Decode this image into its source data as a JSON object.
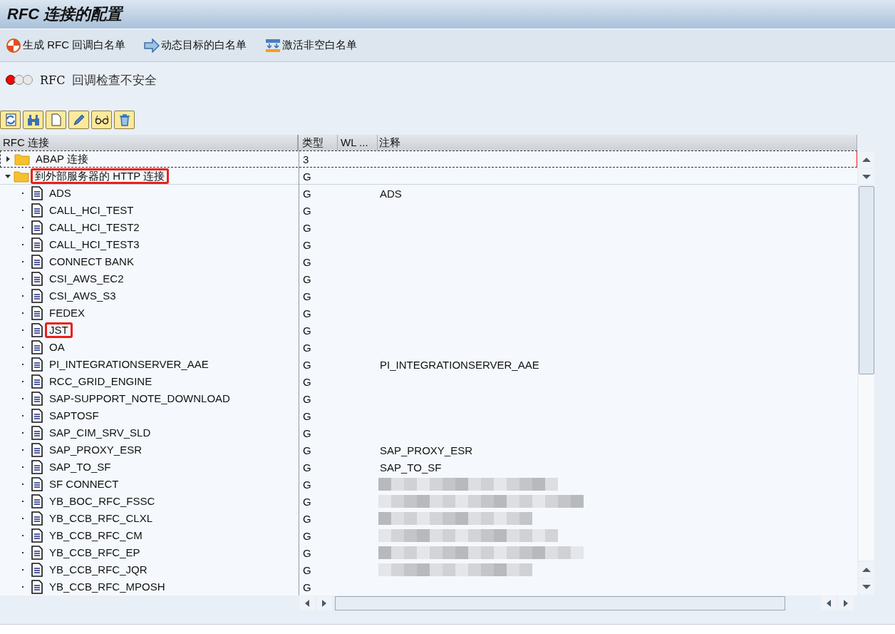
{
  "window": {
    "title": "RFC 连接的配置"
  },
  "app_toolbar": [
    {
      "kind": "generate",
      "label": "生成 RFC 回调白名单"
    },
    {
      "kind": "arrow",
      "label": "动态目标的白名单"
    },
    {
      "kind": "activate",
      "label": "激活非空白名单"
    }
  ],
  "status": {
    "alert": true,
    "label": "RFC",
    "text": "回调检查不安全"
  },
  "icon_toolbar": [
    {
      "kind": "refresh"
    },
    {
      "kind": "binoculars"
    },
    {
      "kind": "page"
    },
    {
      "kind": "pencil"
    },
    {
      "kind": "glasses"
    },
    {
      "kind": "trash"
    }
  ],
  "table": {
    "columns": [
      "RFC 连接",
      "类型",
      "WL ...",
      "注释"
    ],
    "tree": [
      {
        "label": "ABAP 连接",
        "type": "3",
        "expanded": false,
        "focused": true,
        "highlighted": false
      },
      {
        "label": "到外部服务器的 HTTP 连接",
        "type": "G",
        "expanded": true,
        "focused": false,
        "highlighted": true,
        "children": [
          {
            "label": "ADS",
            "type": "G",
            "comment": "ADS",
            "highlighted": false,
            "redacted": false
          },
          {
            "label": "CALL_HCI_TEST",
            "type": "G",
            "highlighted": false,
            "redacted": false
          },
          {
            "label": "CALL_HCI_TEST2",
            "type": "G",
            "highlighted": false,
            "redacted": false
          },
          {
            "label": "CALL_HCI_TEST3",
            "type": "G",
            "highlighted": false,
            "redacted": false
          },
          {
            "label": "CONNECT BANK",
            "type": "G",
            "highlighted": false,
            "redacted": false
          },
          {
            "label": "CSI_AWS_EC2",
            "type": "G",
            "highlighted": false,
            "redacted": false
          },
          {
            "label": "CSI_AWS_S3",
            "type": "G",
            "highlighted": false,
            "redacted": false
          },
          {
            "label": "FEDEX",
            "type": "G",
            "highlighted": false,
            "redacted": false
          },
          {
            "label": "JST",
            "type": "G",
            "highlighted": true,
            "redacted": false
          },
          {
            "label": "OA",
            "type": "G",
            "highlighted": false,
            "redacted": false
          },
          {
            "label": "PI_INTEGRATIONSERVER_AAE",
            "type": "G",
            "comment": "PI_INTEGRATIONSERVER_AAE",
            "highlighted": false,
            "redacted": false
          },
          {
            "label": "RCC_GRID_ENGINE",
            "type": "G",
            "highlighted": false,
            "redacted": false
          },
          {
            "label": "SAP-SUPPORT_NOTE_DOWNLOAD",
            "type": "G",
            "highlighted": false,
            "redacted": false
          },
          {
            "label": "SAPTOSF",
            "type": "G",
            "highlighted": false,
            "redacted": false
          },
          {
            "label": "SAP_CIM_SRV_SLD",
            "type": "G",
            "highlighted": false,
            "redacted": false
          },
          {
            "label": "SAP_PROXY_ESR",
            "type": "G",
            "comment": "SAP_PROXY_ESR",
            "highlighted": false,
            "redacted": false
          },
          {
            "label": "SAP_TO_SF",
            "type": "G",
            "comment": "SAP_TO_SF",
            "highlighted": false,
            "redacted": false
          },
          {
            "label": "SF CONNECT",
            "type": "G",
            "highlighted": false,
            "redacted": true
          },
          {
            "label": "YB_BOC_RFC_FSSC",
            "type": "G",
            "highlighted": false,
            "redacted": true
          },
          {
            "label": "YB_CCB_RFC_CLXL",
            "type": "G",
            "highlighted": false,
            "redacted": true
          },
          {
            "label": "YB_CCB_RFC_CM",
            "type": "G",
            "highlighted": false,
            "redacted": true
          },
          {
            "label": "YB_CCB_RFC_EP",
            "type": "G",
            "highlighted": false,
            "redacted": true
          },
          {
            "label": "YB_CCB_RFC_JQR",
            "type": "G",
            "highlighted": false,
            "redacted": true
          },
          {
            "label": "YB_CCB_RFC_MPOSH",
            "type": "G",
            "highlighted": false,
            "redacted": false
          }
        ]
      }
    ]
  }
}
